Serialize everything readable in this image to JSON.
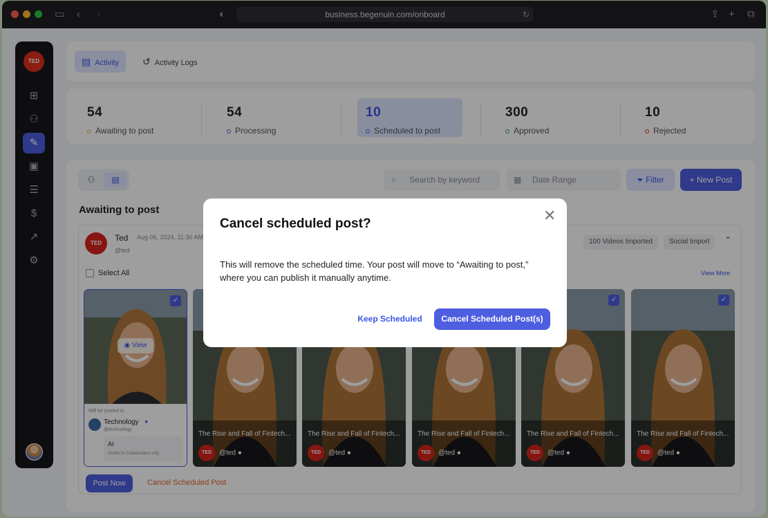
{
  "browser": {
    "url": "business.begenuin.com/onboard"
  },
  "brand": {
    "logo_text": "TED",
    "accent_color": "#4d5ee0",
    "brand_color": "#d8241c"
  },
  "tabs": [
    {
      "label": "Activity",
      "active": true,
      "icon": "activity-icon"
    },
    {
      "label": "Activity Logs",
      "active": false,
      "icon": "history-icon"
    }
  ],
  "stats": [
    {
      "value": "54",
      "label": "Awaiting to post",
      "dot_color": "#e6b422"
    },
    {
      "value": "54",
      "label": "Processing",
      "dot_color": "#4d5ee0"
    },
    {
      "value": "10",
      "label": "Scheduled to post",
      "dot_color": "#4d5ee0",
      "active": true
    },
    {
      "value": "300",
      "label": "Approved",
      "dot_color": "#2f9e63"
    },
    {
      "value": "10",
      "label": "Rejected",
      "dot_color": "#e0301e"
    }
  ],
  "toolbar": {
    "search_placeholder": "Search by keyword",
    "date_placeholder": "Date Range",
    "filter_label": "Filter",
    "new_post_label": "New Post"
  },
  "section": {
    "title": "Awaiting to post"
  },
  "post": {
    "author": "Ted",
    "date": "Aug 06, 2024, 11:30 AM",
    "handle": "@ted",
    "chips": [
      "100 Videos Imported",
      "Social Import"
    ],
    "select_all": "Select All",
    "view_more": "View More",
    "view_label": "View",
    "will_be_posted_in": "Will be posted in",
    "community_name": "Technology",
    "community_handle": "@technology",
    "ai_label": "AI",
    "visibility": "Visible to Collaborators only",
    "thumb_title": "The Rise and Fall of Fintech...",
    "thumb_handle": "@ted",
    "post_now": "Post Now",
    "cancel_scheduled": "Cancel Scheduled Post"
  },
  "modal": {
    "title": "Cancel scheduled post?",
    "body": "This will remove the scheduled time. Your post will move to “Awaiting to post,” where you can publish it manually anytime.",
    "keep_label": "Keep Scheduled",
    "confirm_label": "Cancel Scheduled Post(s)"
  }
}
